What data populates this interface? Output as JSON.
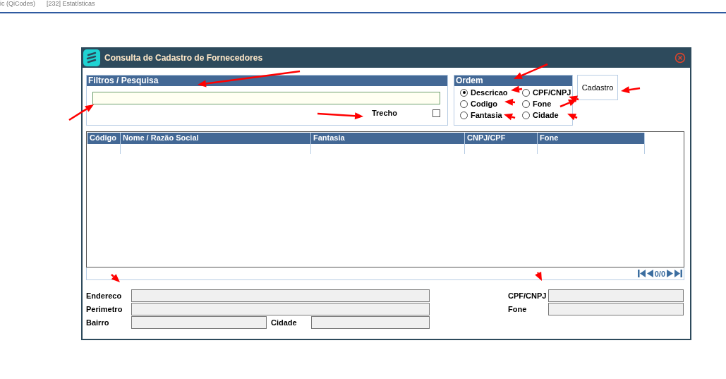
{
  "top_tabs": [
    "ic (QiCodes)",
    "[232] Estatísticas"
  ],
  "window": {
    "title": "Consulta de Cadastro de Fornecedores"
  },
  "filters": {
    "title": "Filtros / Pesquisa",
    "trecho": {
      "label": "Trecho",
      "checked": false
    }
  },
  "order": {
    "title": "Ordem",
    "options": [
      {
        "label": "Descricao",
        "selected": true
      },
      {
        "label": "CPF/CNPJ",
        "selected": false
      },
      {
        "label": "Codigo",
        "selected": false
      },
      {
        "label": "Fone",
        "selected": false
      },
      {
        "label": "Fantasia",
        "selected": false
      },
      {
        "label": "Cidade",
        "selected": false
      }
    ]
  },
  "cadastro_button": "Cadastro",
  "table": {
    "columns": [
      "Código",
      "Nome / Razão Social",
      "Fantasia",
      "CNPJ/CPF",
      "Fone"
    ]
  },
  "pager": {
    "count": "0/0"
  },
  "details": {
    "endereco": "Endereco",
    "perimetro": "Perimetro",
    "bairro": "Bairro",
    "cidade": "Cidade",
    "cpf_cnpj": "CPF/CNPJ",
    "fone": "Fone"
  }
}
